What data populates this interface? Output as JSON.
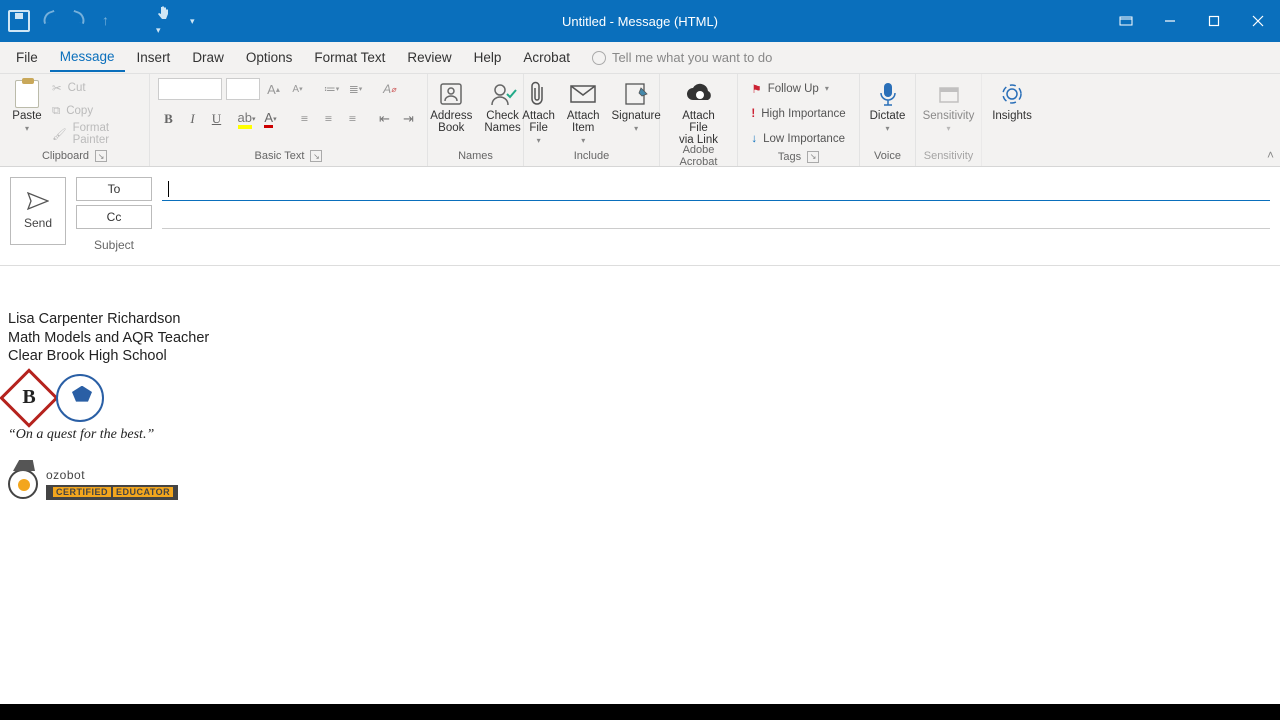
{
  "title": "Untitled - Message (HTML)",
  "tabs": {
    "file": "File",
    "message": "Message",
    "insert": "Insert",
    "draw": "Draw",
    "options": "Options",
    "format_text": "Format Text",
    "review": "Review",
    "help": "Help",
    "acrobat": "Acrobat",
    "tellme_placeholder": "Tell me what you want to do"
  },
  "ribbon": {
    "clipboard": {
      "paste": "Paste",
      "cut": "Cut",
      "copy": "Copy",
      "format_painter": "Format Painter",
      "label": "Clipboard"
    },
    "basic_text": {
      "label": "Basic Text"
    },
    "names": {
      "address_book": "Address\nBook",
      "check_names": "Check\nNames",
      "label": "Names"
    },
    "include": {
      "attach_file": "Attach\nFile",
      "attach_item": "Attach\nItem",
      "signature": "Signature",
      "label": "Include"
    },
    "adobe": {
      "attach_link": "Attach File\nvia Link",
      "label": "Adobe Acrobat"
    },
    "tags": {
      "follow_up": "Follow Up",
      "high": "High Importance",
      "low": "Low Importance",
      "label": "Tags"
    },
    "voice": {
      "dictate": "Dictate",
      "label": "Voice"
    },
    "sensitivity": {
      "btn": "Sensitivity",
      "label": "Sensitivity"
    },
    "insights": {
      "btn": "Insights"
    }
  },
  "header": {
    "send": "Send",
    "to": "To",
    "cc": "Cc",
    "subject": "Subject",
    "to_value": "",
    "cc_value": "",
    "subject_value": ""
  },
  "signature": {
    "name": "Lisa Carpenter Richardson",
    "title": "Math Models and AQR Teacher",
    "school": "Clear Brook High School",
    "quote": "“On a quest for the best.”",
    "ozobot_brand": "ozobot",
    "ozobot_cert": "CERTIFIED",
    "ozobot_edu": "EDUCATOR"
  }
}
